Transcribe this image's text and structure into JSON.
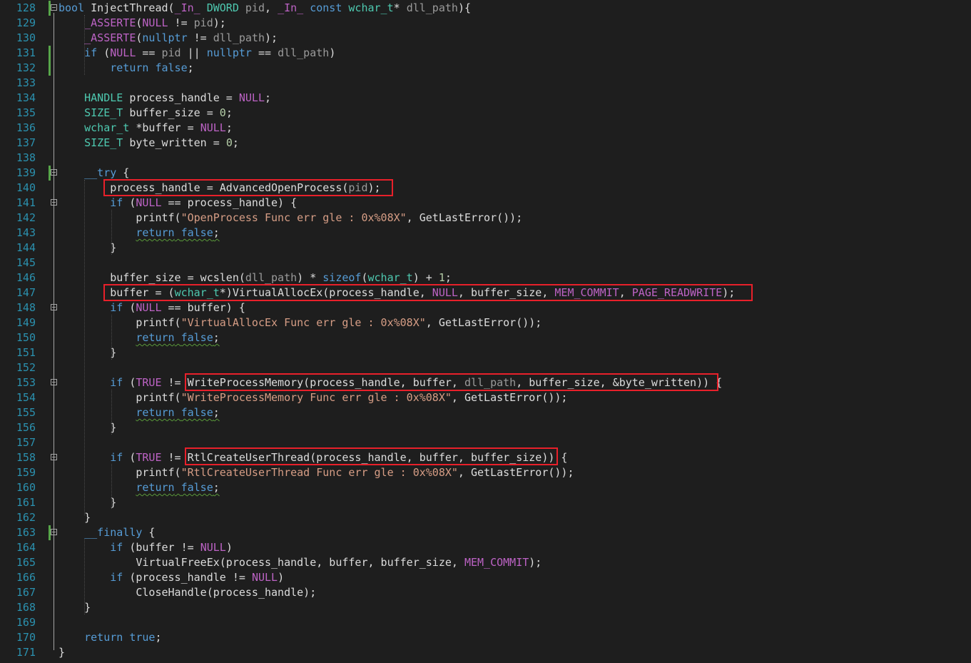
{
  "editor": {
    "theme_colors": {
      "background": "#1e1e1e",
      "line_number": "#2b91af",
      "keyword": "#569cd6",
      "type": "#4ec9b0",
      "macro": "#bd63c5",
      "string": "#d69d85",
      "number": "#b5cea8",
      "highlight_box": "#e8202a"
    },
    "lines": [
      {
        "n": "128",
        "fold": true,
        "chg": true,
        "tokens": [
          [
            "kw",
            "bool"
          ],
          [
            "fn",
            " InjectThread("
          ],
          [
            "ann",
            "_In_"
          ],
          [
            "fn",
            " "
          ],
          [
            "ty",
            "DWORD"
          ],
          [
            "prm",
            " pid"
          ],
          [
            "fn",
            ", "
          ],
          [
            "ann",
            "_In_"
          ],
          [
            "fn",
            " "
          ],
          [
            "kw",
            "const"
          ],
          [
            "fn",
            " "
          ],
          [
            "ty",
            "wchar_t"
          ],
          [
            "fn",
            "* "
          ],
          [
            "prm",
            "dll_path"
          ],
          [
            "fn",
            "){"
          ]
        ]
      },
      {
        "n": "129",
        "tokens": [
          [
            "fn",
            "    "
          ],
          [
            "mac",
            "_ASSERTE"
          ],
          [
            "fn",
            "("
          ],
          [
            "mac",
            "NULL"
          ],
          [
            "fn",
            " != "
          ],
          [
            "prm",
            "pid"
          ],
          [
            "fn",
            ");"
          ]
        ]
      },
      {
        "n": "130",
        "tokens": [
          [
            "fn",
            "    "
          ],
          [
            "mac",
            "_ASSERTE"
          ],
          [
            "fn",
            "("
          ],
          [
            "kw",
            "nullptr"
          ],
          [
            "fn",
            " != "
          ],
          [
            "prm",
            "dll_path"
          ],
          [
            "fn",
            ");"
          ]
        ]
      },
      {
        "n": "131",
        "chg": true,
        "tokens": [
          [
            "fn",
            "    "
          ],
          [
            "kw",
            "if"
          ],
          [
            "fn",
            " ("
          ],
          [
            "mac",
            "NULL"
          ],
          [
            "fn",
            " == "
          ],
          [
            "prm",
            "pid"
          ],
          [
            "fn",
            " || "
          ],
          [
            "kw",
            "nullptr"
          ],
          [
            "fn",
            " == "
          ],
          [
            "prm",
            "dll_path"
          ],
          [
            "fn",
            ")"
          ]
        ]
      },
      {
        "n": "132",
        "chg": true,
        "tokens": [
          [
            "fn",
            "        "
          ],
          [
            "kw",
            "return"
          ],
          [
            "fn",
            " "
          ],
          [
            "kw",
            "false"
          ],
          [
            "fn",
            ";"
          ]
        ]
      },
      {
        "n": "133",
        "tokens": []
      },
      {
        "n": "134",
        "tokens": [
          [
            "fn",
            "    "
          ],
          [
            "ty",
            "HANDLE"
          ],
          [
            "fn",
            " process_handle = "
          ],
          [
            "mac",
            "NULL"
          ],
          [
            "fn",
            ";"
          ]
        ]
      },
      {
        "n": "135",
        "tokens": [
          [
            "fn",
            "    "
          ],
          [
            "ty",
            "SIZE_T"
          ],
          [
            "fn",
            " buffer_size = "
          ],
          [
            "num",
            "0"
          ],
          [
            "fn",
            ";"
          ]
        ]
      },
      {
        "n": "136",
        "tokens": [
          [
            "fn",
            "    "
          ],
          [
            "ty",
            "wchar_t"
          ],
          [
            "fn",
            " *buffer = "
          ],
          [
            "mac",
            "NULL"
          ],
          [
            "fn",
            ";"
          ]
        ]
      },
      {
        "n": "137",
        "tokens": [
          [
            "fn",
            "    "
          ],
          [
            "ty",
            "SIZE_T"
          ],
          [
            "fn",
            " byte_written = "
          ],
          [
            "num",
            "0"
          ],
          [
            "fn",
            ";"
          ]
        ]
      },
      {
        "n": "138",
        "tokens": []
      },
      {
        "n": "139",
        "fold": true,
        "chg": true,
        "tokens": [
          [
            "fn",
            "    "
          ],
          [
            "kw",
            "__try"
          ],
          [
            "fn",
            " {"
          ]
        ]
      },
      {
        "n": "140",
        "tokens": [
          [
            "fn",
            "        process_handle = AdvancedOpenProcess("
          ],
          [
            "prm",
            "pid"
          ],
          [
            "fn",
            ");"
          ]
        ]
      },
      {
        "n": "141",
        "fold": true,
        "tokens": [
          [
            "fn",
            "        "
          ],
          [
            "kw",
            "if"
          ],
          [
            "fn",
            " ("
          ],
          [
            "mac",
            "NULL"
          ],
          [
            "fn",
            " == process_handle) {"
          ]
        ]
      },
      {
        "n": "142",
        "tokens": [
          [
            "fn",
            "            printf("
          ],
          [
            "str",
            "\"OpenProcess Func err gle : 0x%08X\""
          ],
          [
            "fn",
            ", GetLastError());"
          ]
        ]
      },
      {
        "n": "143",
        "tokens": [
          [
            "fn",
            "            "
          ],
          [
            "kw",
            "return"
          ],
          [
            "fn",
            " "
          ],
          [
            "kw",
            "false"
          ],
          [
            "fn",
            ";"
          ]
        ],
        "squig": true
      },
      {
        "n": "144",
        "tokens": [
          [
            "fn",
            "        }"
          ]
        ]
      },
      {
        "n": "145",
        "tokens": []
      },
      {
        "n": "146",
        "tokens": [
          [
            "fn",
            "        buffer_size = wcslen("
          ],
          [
            "prm",
            "dll_path"
          ],
          [
            "fn",
            ") * "
          ],
          [
            "kw",
            "sizeof"
          ],
          [
            "fn",
            "("
          ],
          [
            "ty",
            "wchar_t"
          ],
          [
            "fn",
            ") + "
          ],
          [
            "num",
            "1"
          ],
          [
            "fn",
            ";"
          ]
        ]
      },
      {
        "n": "147",
        "tokens": [
          [
            "fn",
            "        buffer = ("
          ],
          [
            "ty",
            "wchar_t"
          ],
          [
            "fn",
            "*)VirtualAllocEx(process_handle, "
          ],
          [
            "mac",
            "NULL"
          ],
          [
            "fn",
            ", buffer_size, "
          ],
          [
            "mac",
            "MEM_COMMIT"
          ],
          [
            "fn",
            ", "
          ],
          [
            "mac",
            "PAGE_READWRITE"
          ],
          [
            "fn",
            ");"
          ]
        ]
      },
      {
        "n": "148",
        "fold": true,
        "tokens": [
          [
            "fn",
            "        "
          ],
          [
            "kw",
            "if"
          ],
          [
            "fn",
            " ("
          ],
          [
            "mac",
            "NULL"
          ],
          [
            "fn",
            " == buffer) {"
          ]
        ]
      },
      {
        "n": "149",
        "tokens": [
          [
            "fn",
            "            printf("
          ],
          [
            "str",
            "\"VirtualAllocEx Func err gle : 0x%08X\""
          ],
          [
            "fn",
            ", GetLastError());"
          ]
        ]
      },
      {
        "n": "150",
        "tokens": [
          [
            "fn",
            "            "
          ],
          [
            "kw",
            "return"
          ],
          [
            "fn",
            " "
          ],
          [
            "kw",
            "false"
          ],
          [
            "fn",
            ";"
          ]
        ],
        "squig": true
      },
      {
        "n": "151",
        "tokens": [
          [
            "fn",
            "        }"
          ]
        ]
      },
      {
        "n": "152",
        "tokens": []
      },
      {
        "n": "153",
        "fold": true,
        "tokens": [
          [
            "fn",
            "        "
          ],
          [
            "kw",
            "if"
          ],
          [
            "fn",
            " ("
          ],
          [
            "mac",
            "TRUE"
          ],
          [
            "fn",
            " != WriteProcessMemory(process_handle, buffer, "
          ],
          [
            "prm",
            "dll_path"
          ],
          [
            "fn",
            ", buffer_size, &byte_written)) {"
          ]
        ]
      },
      {
        "n": "154",
        "tokens": [
          [
            "fn",
            "            printf("
          ],
          [
            "str",
            "\"WriteProcessMemory Func err gle : 0x%08X\""
          ],
          [
            "fn",
            ", GetLastError());"
          ]
        ]
      },
      {
        "n": "155",
        "tokens": [
          [
            "fn",
            "            "
          ],
          [
            "kw",
            "return"
          ],
          [
            "fn",
            " "
          ],
          [
            "kw",
            "false"
          ],
          [
            "fn",
            ";"
          ]
        ],
        "squig": true
      },
      {
        "n": "156",
        "tokens": [
          [
            "fn",
            "        }"
          ]
        ]
      },
      {
        "n": "157",
        "tokens": []
      },
      {
        "n": "158",
        "fold": true,
        "tokens": [
          [
            "fn",
            "        "
          ],
          [
            "kw",
            "if"
          ],
          [
            "fn",
            " ("
          ],
          [
            "mac",
            "TRUE"
          ],
          [
            "fn",
            " != RtlCreateUserThread(process_handle, buffer, buffer_size)) {"
          ]
        ]
      },
      {
        "n": "159",
        "tokens": [
          [
            "fn",
            "            printf("
          ],
          [
            "str",
            "\"RtlCreateUserThread Func err gle : 0x%08X\""
          ],
          [
            "fn",
            ", GetLastError());"
          ]
        ]
      },
      {
        "n": "160",
        "tokens": [
          [
            "fn",
            "            "
          ],
          [
            "kw",
            "return"
          ],
          [
            "fn",
            " "
          ],
          [
            "kw",
            "false"
          ],
          [
            "fn",
            ";"
          ]
        ],
        "squig": true
      },
      {
        "n": "161",
        "tokens": [
          [
            "fn",
            "        }"
          ]
        ]
      },
      {
        "n": "162",
        "tokens": [
          [
            "fn",
            "    }"
          ]
        ]
      },
      {
        "n": "163",
        "fold": true,
        "chg": true,
        "tokens": [
          [
            "fn",
            "    "
          ],
          [
            "kw",
            "__finally"
          ],
          [
            "fn",
            " {"
          ]
        ]
      },
      {
        "n": "164",
        "tokens": [
          [
            "fn",
            "        "
          ],
          [
            "kw",
            "if"
          ],
          [
            "fn",
            " (buffer != "
          ],
          [
            "mac",
            "NULL"
          ],
          [
            "fn",
            ")"
          ]
        ]
      },
      {
        "n": "165",
        "tokens": [
          [
            "fn",
            "            VirtualFreeEx(process_handle, buffer, buffer_size, "
          ],
          [
            "mac",
            "MEM_COMMIT"
          ],
          [
            "fn",
            ");"
          ]
        ]
      },
      {
        "n": "166",
        "tokens": [
          [
            "fn",
            "        "
          ],
          [
            "kw",
            "if"
          ],
          [
            "fn",
            " (process_handle != "
          ],
          [
            "mac",
            "NULL"
          ],
          [
            "fn",
            ")"
          ]
        ]
      },
      {
        "n": "167",
        "tokens": [
          [
            "fn",
            "            CloseHandle(process_handle);"
          ]
        ]
      },
      {
        "n": "168",
        "tokens": [
          [
            "fn",
            "    }"
          ]
        ]
      },
      {
        "n": "169",
        "tokens": []
      },
      {
        "n": "170",
        "tokens": [
          [
            "fn",
            "    "
          ],
          [
            "kw",
            "return"
          ],
          [
            "fn",
            " "
          ],
          [
            "kw",
            "true"
          ],
          [
            "fn",
            ";"
          ]
        ]
      },
      {
        "n": "171",
        "tokens": [
          [
            "fn",
            "}"
          ]
        ]
      }
    ]
  }
}
